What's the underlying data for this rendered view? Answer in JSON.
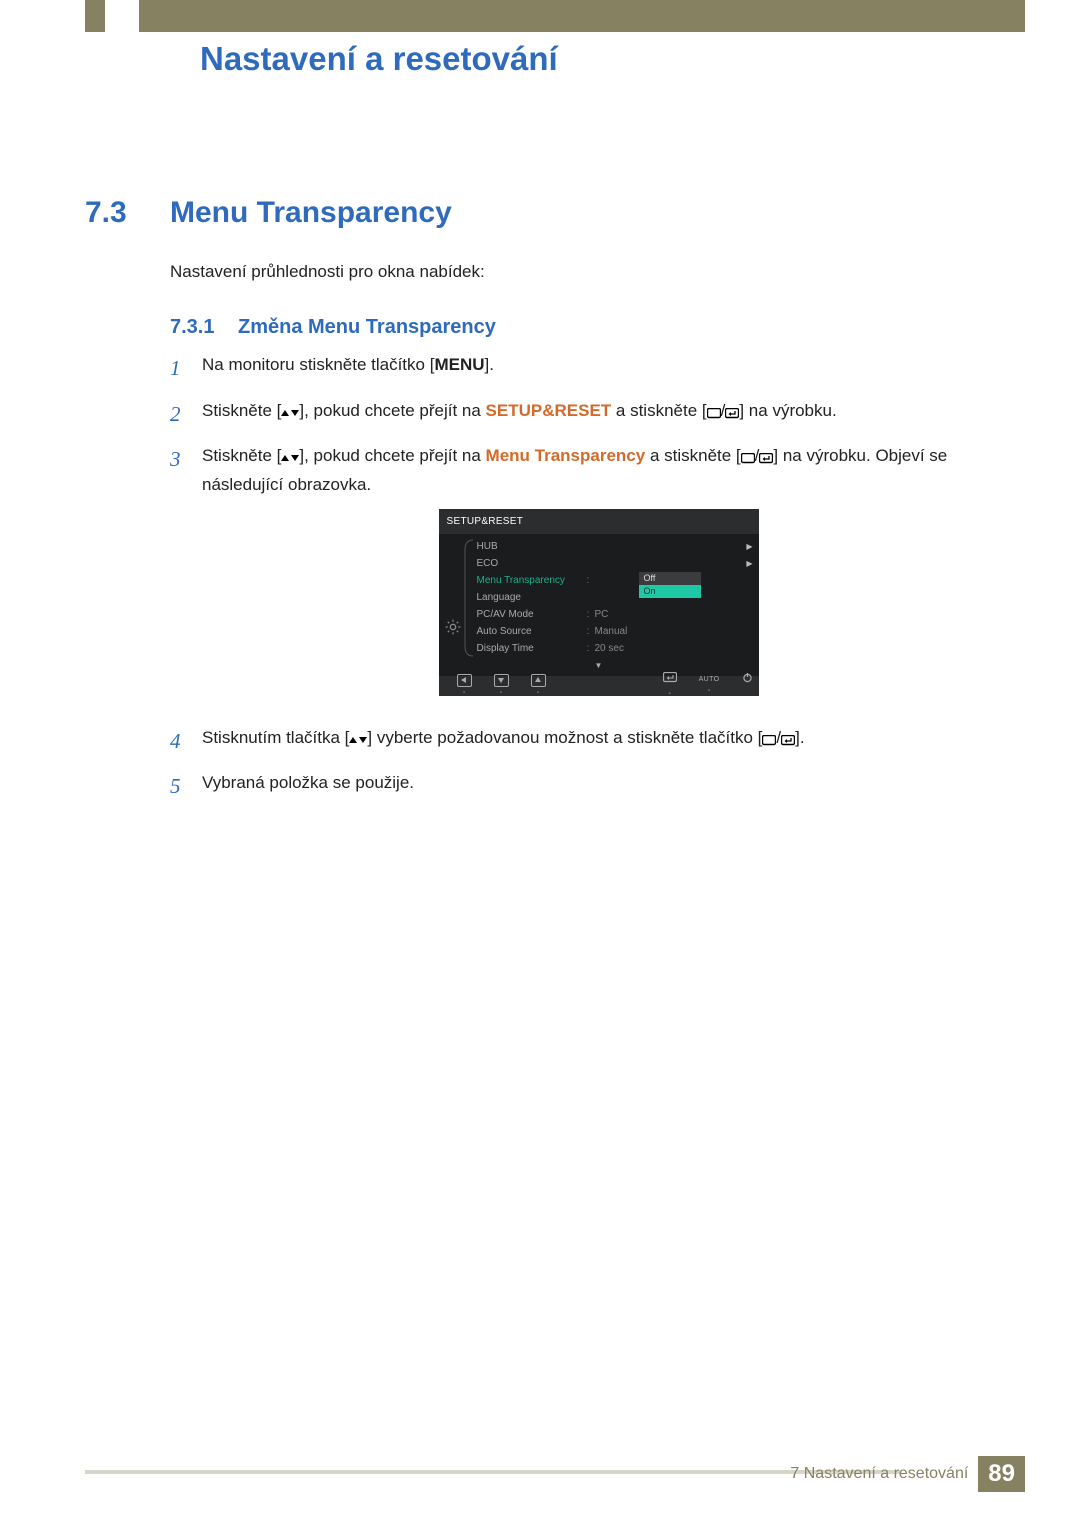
{
  "header": {
    "chapter_title": "Nastavení a resetování"
  },
  "section": {
    "number": "7.3",
    "title": "Menu Transparency",
    "intro": "Nastavení průhlednosti pro okna nabídek:"
  },
  "subsection": {
    "number": "7.3.1",
    "title": "Změna Menu Transparency"
  },
  "steps": {
    "s1_a": "Na monitoru stiskněte tlačítko [",
    "s1_b": "MENU",
    "s1_c": "].",
    "s2_a": "Stiskněte [",
    "s2_b": "], pokud chcete přejít na ",
    "s2_c": "SETUP&RESET",
    "s2_d": " a stiskněte [",
    "s2_e": "] na výrobku.",
    "s3_a": "Stiskněte [",
    "s3_b": "], pokud chcete přejít na ",
    "s3_c": "Menu Transparency",
    "s3_d": " a stiskněte [",
    "s3_e": "] na výrobku. Objeví se následující obrazovka.",
    "s4_a": "Stisknutím tlačítka [",
    "s4_b": "] vyberte požadovanou možnost a stiskněte tlačítko [",
    "s4_c": "].",
    "s5": "Vybraná položka se použije."
  },
  "osd": {
    "title": "SETUP&RESET",
    "rows": [
      {
        "label": "HUB",
        "has_arrow": true
      },
      {
        "label": "ECO",
        "has_arrow": true
      },
      {
        "label": "Menu Transparency",
        "highlight": true
      },
      {
        "label": "Language"
      },
      {
        "label": "PC/AV Mode",
        "value": "PC"
      },
      {
        "label": "Auto Source",
        "value": "Manual"
      },
      {
        "label": "Display Time",
        "value": "20 sec"
      }
    ],
    "dropdown": {
      "off": "Off",
      "on": "On"
    },
    "bar": {
      "auto": "AUTO"
    }
  },
  "footer": {
    "label": "7 Nastavení a resetování",
    "page": "89"
  }
}
